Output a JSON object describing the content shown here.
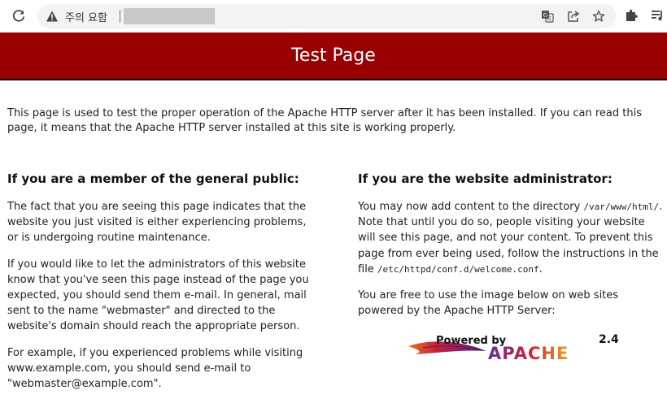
{
  "browser": {
    "security_label": "주의 요함",
    "icons": [
      "reload-icon",
      "warning-icon",
      "translate-icon",
      "share-icon",
      "bookmark-star-icon",
      "extensions-icon",
      "media-control-icon"
    ]
  },
  "page": {
    "title": "Test Page",
    "intro": "This page is used to test the proper operation of the Apache HTTP server after it has been installed. If you can read this page, it means that the Apache HTTP server installed at this site is working properly.",
    "public": {
      "heading": "If you are a member of the general public:",
      "p1": "The fact that you are seeing this page indicates that the website you just visited is either experiencing problems, or is undergoing routine maintenance.",
      "p2": "If you would like to let the administrators of this website know that you've seen this page instead of the page you expected, you should send them e-mail. In general, mail sent to the name \"webmaster\" and directed to the website's domain should reach the appropriate person.",
      "p3": "For example, if you experienced problems while visiting www.example.com, you should send e-mail to \"webmaster@example.com\"."
    },
    "admin": {
      "heading": "If you are the website administrator:",
      "p1_a": "You may now add content to the directory ",
      "p1_dir": "/var/www/html/",
      "p1_b": ". Note that until you do so, people visiting your website will see this page, and not your content. To prevent this page from ever being used, follow the instructions in the file ",
      "p1_file": "/etc/httpd/conf.d/welcome.conf",
      "p1_c": ".",
      "p2": "You are free to use the image below on web sites powered by the Apache HTTP Server:"
    },
    "logo": {
      "powered_by": "Powered by",
      "version": "2.4",
      "name": "APACHE"
    }
  },
  "colors": {
    "header_bg": "#990000",
    "header_text": "#ffffff"
  }
}
